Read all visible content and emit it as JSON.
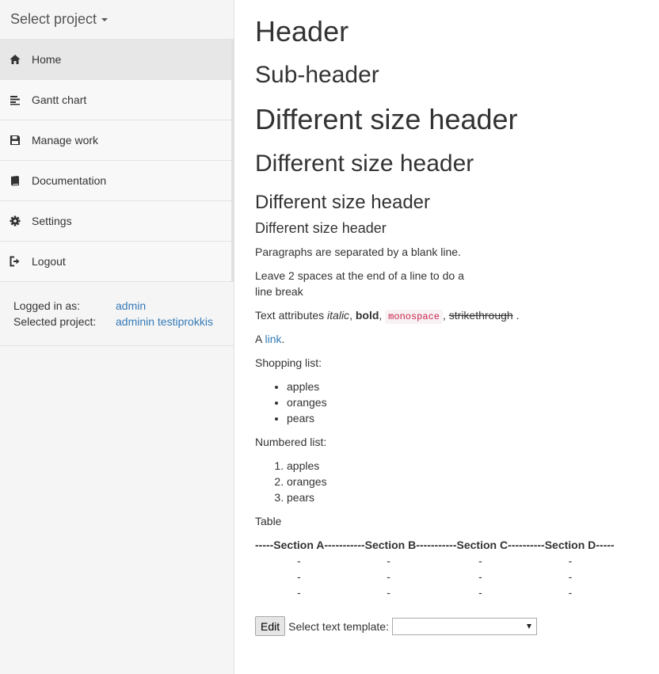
{
  "sidebar": {
    "project_select": "Select project",
    "items": [
      {
        "label": "Home",
        "icon": "home-icon"
      },
      {
        "label": "Gantt chart",
        "icon": "gantt-icon"
      },
      {
        "label": "Manage work",
        "icon": "floppy-disk-icon"
      },
      {
        "label": "Documentation",
        "icon": "book-icon"
      },
      {
        "label": "Settings",
        "icon": "gear-icon"
      },
      {
        "label": "Logout",
        "icon": "logout-icon"
      }
    ],
    "logged_in_label": "Logged in as:",
    "logged_in_value": "admin",
    "selected_project_label": "Selected project:",
    "selected_project_value": "adminin testiprokkis"
  },
  "content": {
    "h_header": "Header",
    "h_subheader": "Sub-header",
    "h_diff1": "Different size header",
    "h_diff2": "Different size header",
    "h_diff3": "Different size header",
    "h_diff4": "Different size header",
    "p1": "Paragraphs are separated by a blank line.",
    "p2_line1": "Leave 2 spaces at the end of a line to do a",
    "p2_line2": "line break",
    "attrs_prefix": "Text attributes ",
    "attrs_italic": "italic",
    "attrs_bold": "bold",
    "attrs_mono": "monospace",
    "attrs_strike": "strikethrough",
    "link_prefix": "A ",
    "link_text": "link",
    "link_suffix": ".",
    "shopping_label": "Shopping list:",
    "shopping_items": [
      "apples",
      "oranges",
      "pears"
    ],
    "numbered_label": "Numbered list:",
    "numbered_items": [
      "apples",
      "oranges",
      "pears"
    ],
    "table_label": "Table",
    "table_headers": [
      "-----Section A-----",
      "------Section B-----",
      "------Section C-----",
      "-----Section D-----"
    ],
    "table_rows": [
      [
        "-",
        "-",
        "-",
        "-"
      ],
      [
        "-",
        "-",
        "-",
        "-"
      ],
      [
        "-",
        "-",
        "-",
        "-"
      ]
    ],
    "edit_button": "Edit",
    "template_label": "Select text template:",
    "template_value": ""
  }
}
